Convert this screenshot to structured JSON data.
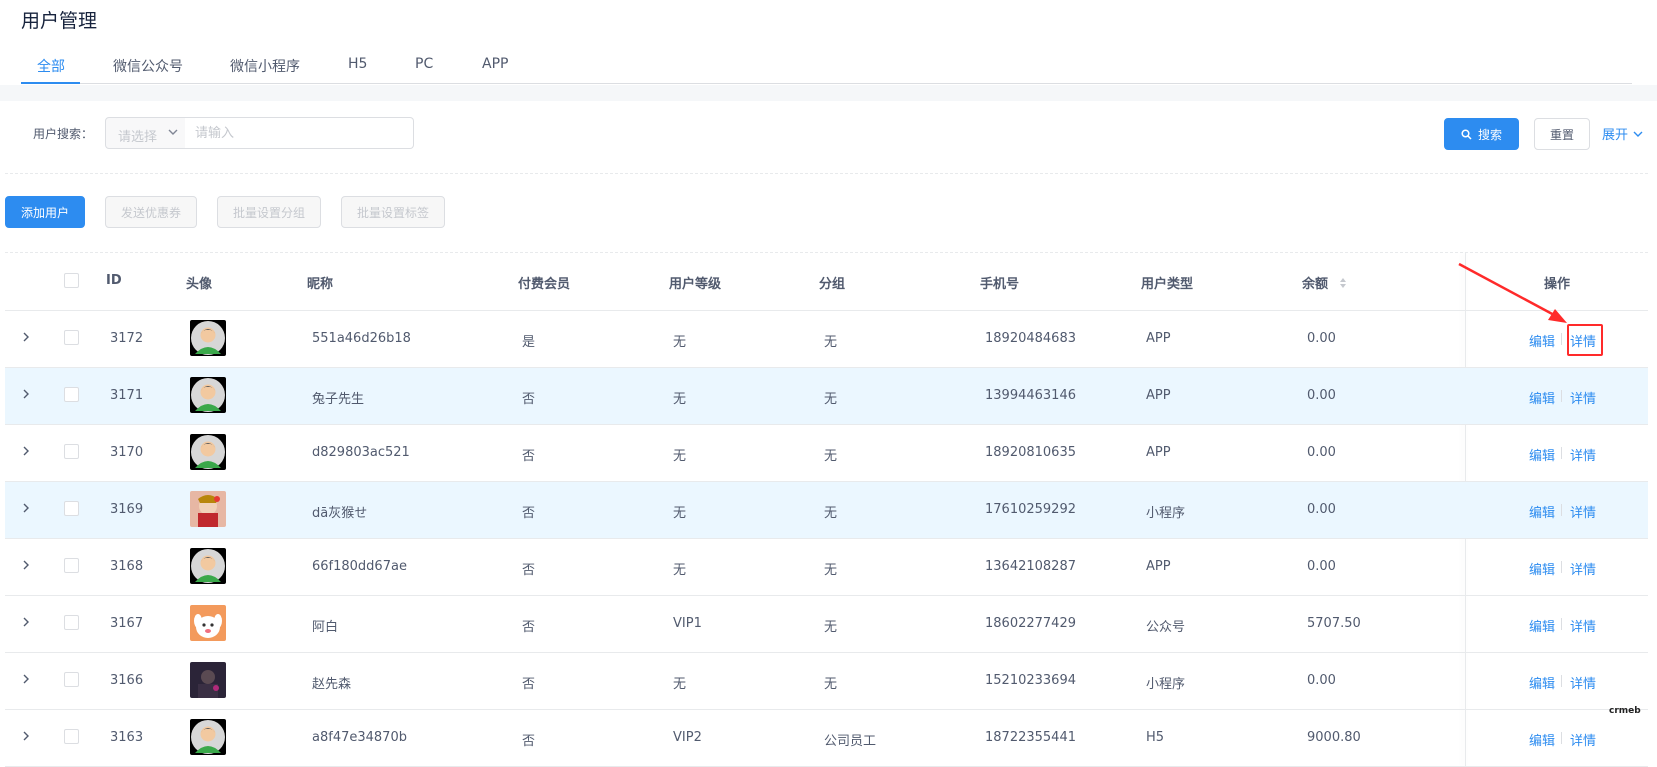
{
  "page": {
    "title": "用户管理"
  },
  "tabs": [
    {
      "label": "全部",
      "active": true
    },
    {
      "label": "微信公众号",
      "active": false
    },
    {
      "label": "微信小程序",
      "active": false
    },
    {
      "label": "H5",
      "active": false
    },
    {
      "label": "PC",
      "active": false
    },
    {
      "label": "APP",
      "active": false
    }
  ],
  "search": {
    "label": "用户搜索：",
    "select_placeholder": "请选择",
    "input_placeholder": "请输入",
    "search_button": "搜索",
    "reset_button": "重置",
    "expand_link": "展开"
  },
  "toolbar": {
    "add_user": "添加用户",
    "send_coupon": "发送优惠券",
    "batch_group": "批量设置分组",
    "batch_tag": "批量设置标签"
  },
  "table": {
    "headers": {
      "id": "ID",
      "avatar": "头像",
      "nickname": "昵称",
      "paid_member": "付费会员",
      "level": "用户等级",
      "group": "分组",
      "phone": "手机号",
      "user_type": "用户类型",
      "balance": "余额",
      "actions": "操作"
    },
    "action_labels": {
      "edit": "编辑",
      "detail": "详情"
    },
    "rows": [
      {
        "id": "3172",
        "nickname": "551a46d26b18",
        "paid": "是",
        "level": "无",
        "group": "无",
        "phone": "18920484683",
        "type": "APP",
        "balance": "0.00",
        "avatar": "default-avatar"
      },
      {
        "id": "3171",
        "nickname": "兔子先生",
        "paid": "否",
        "level": "无",
        "group": "无",
        "phone": "13994463146",
        "type": "APP",
        "balance": "0.00",
        "avatar": "default-avatar"
      },
      {
        "id": "3170",
        "nickname": "d829803ac521",
        "paid": "否",
        "level": "无",
        "group": "无",
        "phone": "18920810635",
        "type": "APP",
        "balance": "0.00",
        "avatar": "default-avatar"
      },
      {
        "id": "3169",
        "nickname": "dā灰猴せ",
        "paid": "否",
        "level": "无",
        "group": "无",
        "phone": "17610259292",
        "type": "小程序",
        "balance": "0.00",
        "avatar": "photo-red"
      },
      {
        "id": "3168",
        "nickname": "66f180dd67ae",
        "paid": "否",
        "level": "无",
        "group": "无",
        "phone": "13642108287",
        "type": "APP",
        "balance": "0.00",
        "avatar": "default-avatar"
      },
      {
        "id": "3167",
        "nickname": "阿白",
        "paid": "否",
        "level": "VIP1",
        "group": "无",
        "phone": "18602277429",
        "type": "公众号",
        "balance": "5707.50",
        "avatar": "cartoon-dog"
      },
      {
        "id": "3166",
        "nickname": "赵先森",
        "paid": "否",
        "level": "无",
        "group": "无",
        "phone": "15210233694",
        "type": "小程序",
        "balance": "0.00",
        "avatar": "photo-dark"
      },
      {
        "id": "3163",
        "nickname": "a8f47e34870b",
        "paid": "否",
        "level": "VIP2",
        "group": "公司员工",
        "phone": "18722355441",
        "type": "H5",
        "balance": "9000.80",
        "avatar": "default-avatar"
      }
    ]
  },
  "watermark": "crmeb",
  "colors": {
    "primary": "#2d8cf0",
    "highlight_row": "#ebf7ff",
    "annotation": "#ff2a2a"
  }
}
